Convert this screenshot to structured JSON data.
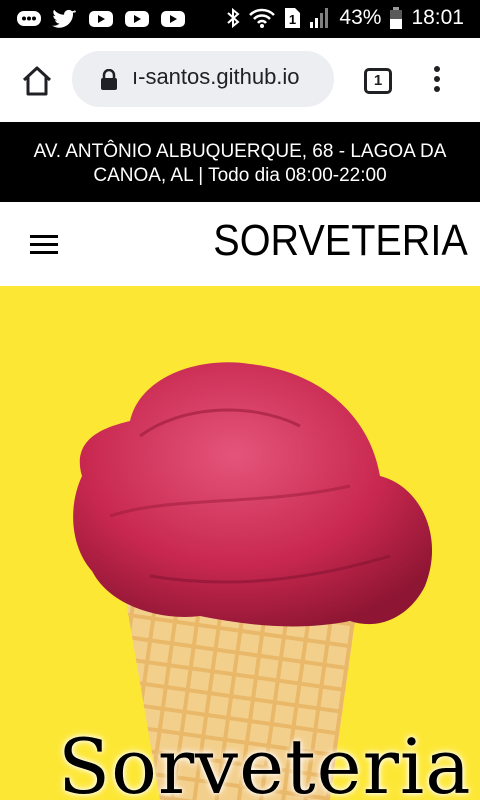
{
  "status_bar": {
    "left_icons": [
      "message-icon",
      "twitter-icon",
      "youtube-icon",
      "youtube-icon",
      "youtube-icon"
    ],
    "right_icons": [
      "bluetooth-icon",
      "wifi-icon",
      "sim-icon",
      "signal-icon",
      "battery-icon"
    ],
    "battery_percent": "43%",
    "time": "18:01"
  },
  "browser": {
    "url": "ı-santos.github.io",
    "tab_count": "1"
  },
  "address": {
    "text": "AV. ANTÔNIO ALBUQUERQUE, 68 - LAGOA DA CANOA, AL | Todo dia 08:00-22:00"
  },
  "header": {
    "site_title": "SORVETERIA"
  },
  "hero": {
    "title": "Sorveteria",
    "background_color": "#fde735",
    "icecream_color": "#c8284f"
  }
}
